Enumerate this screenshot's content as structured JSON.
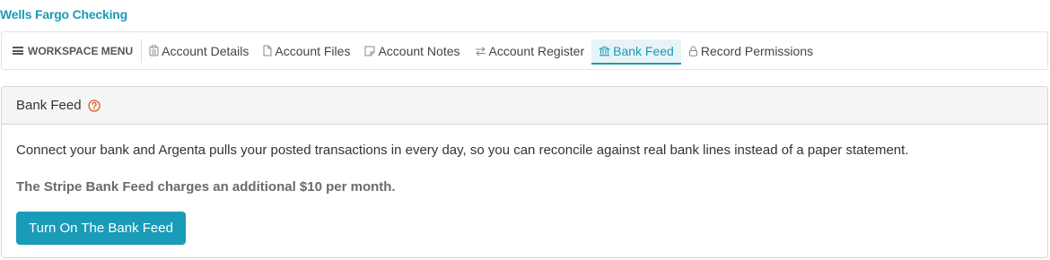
{
  "account": {
    "title": "Wells Fargo Checking"
  },
  "workspace_nav": {
    "menu_label": "WORKSPACE MENU",
    "tabs": [
      {
        "label": "Account Details",
        "icon": "clipboard-icon"
      },
      {
        "label": "Account Files",
        "icon": "file-icon"
      },
      {
        "label": "Account Notes",
        "icon": "note-icon"
      },
      {
        "label": "Account Register",
        "icon": "swap-arrows-icon"
      },
      {
        "label": "Bank Feed",
        "icon": "bank-icon",
        "active": true
      },
      {
        "label": "Record Permissions",
        "icon": "lock-icon"
      }
    ]
  },
  "panel": {
    "title": "Bank Feed",
    "description": "Connect your bank and Argenta pulls your posted transactions in every day, so you can reconcile against real bank lines instead of a paper statement.",
    "pricing_note": "The Stripe Bank Feed charges an additional $10 per month.",
    "button_label": "Turn On The Bank Feed"
  },
  "colors": {
    "accent": "#1a9bb8",
    "help_icon": "#e05a2b",
    "header_bg": "#f5f5f5",
    "active_tab_bg": "#e8f3f6"
  }
}
